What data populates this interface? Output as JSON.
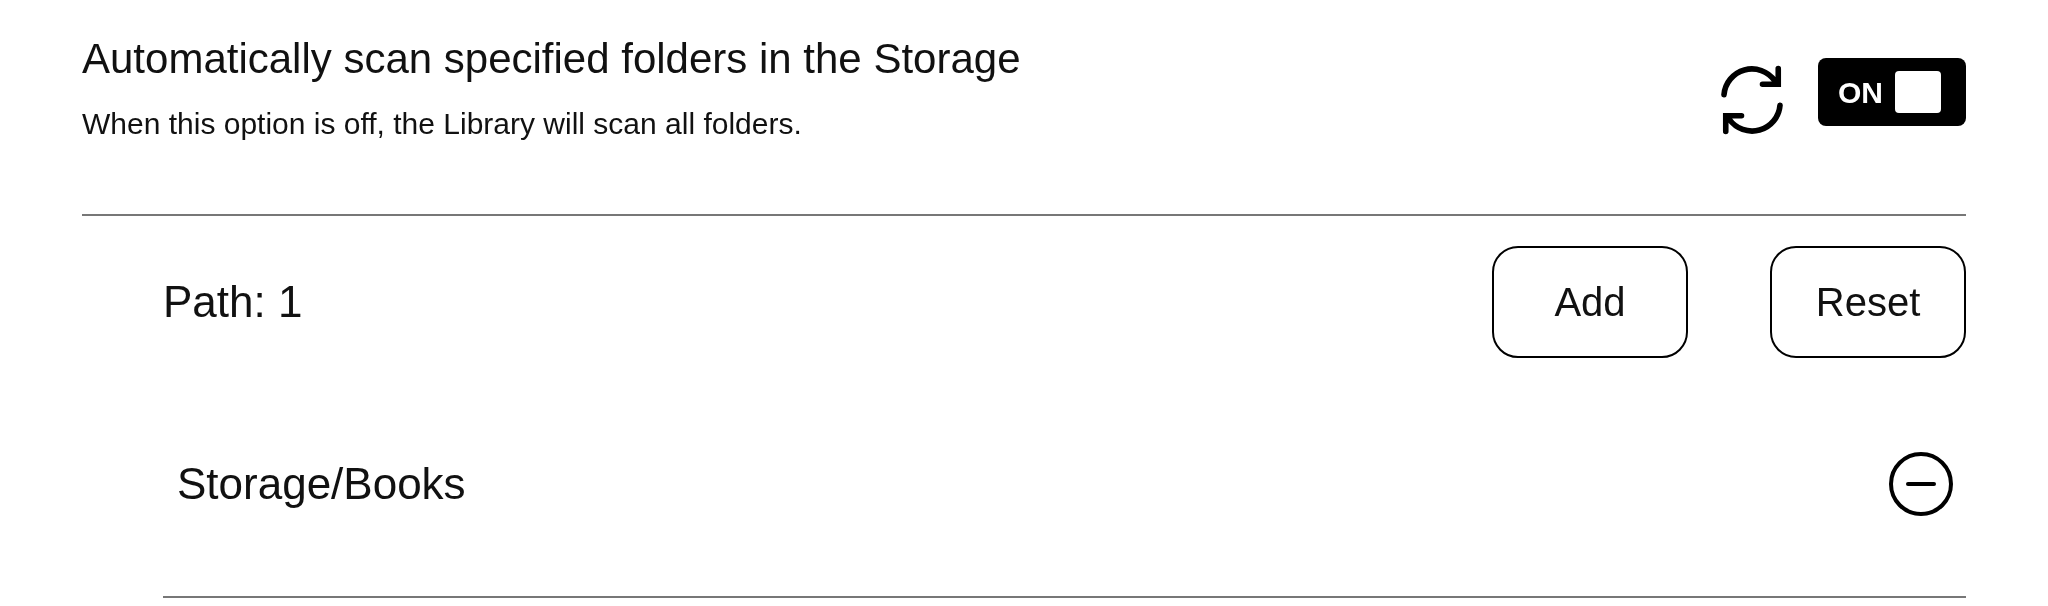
{
  "setting": {
    "title": "Automatically scan specified folders in the Storage",
    "description": "When this option is off, the Library will scan all folders.",
    "toggle": {
      "label": "ON",
      "on": true
    }
  },
  "paths": {
    "label": "Path: 1",
    "buttons": [
      "Add",
      "Reset"
    ],
    "items": [
      {
        "path": "Storage/Books"
      }
    ]
  }
}
